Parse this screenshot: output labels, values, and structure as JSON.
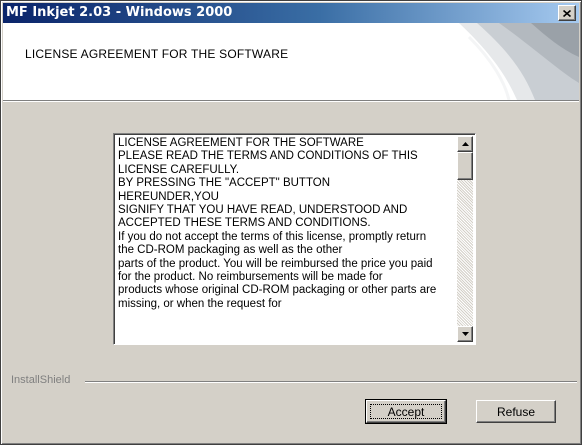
{
  "window": {
    "title": "MF Inkjet  2.03 - Windows 2000"
  },
  "header": {
    "title": "LICENSE AGREEMENT FOR THE SOFTWARE"
  },
  "license": {
    "lines": [
      "LICENSE AGREEMENT FOR THE SOFTWARE",
      "PLEASE READ THE TERMS AND CONDITIONS OF THIS",
      "LICENSE CAREFULLY.",
      "BY PRESSING THE \"ACCEPT\" BUTTON",
      "HEREUNDER,YOU",
      "SIGNIFY THAT YOU HAVE READ, UNDERSTOOD AND",
      "ACCEPTED THESE TERMS AND CONDITIONS.",
      "If you do not accept the terms of this license, promptly return",
      "the CD-ROM packaging as well as the other",
      "parts of the product. You will be reimbursed the price you paid",
      "for the product. No reimbursements will be made for",
      "products whose original CD-ROM packaging or other parts are",
      "missing, or when the request for"
    ]
  },
  "footer": {
    "brand": "InstallShield"
  },
  "buttons": {
    "accept": "Accept",
    "refuse": "Refuse"
  },
  "icons": {
    "close": "close-icon",
    "scroll_up": "arrow-up-icon",
    "scroll_down": "arrow-down-icon"
  },
  "colors": {
    "titlebar_start": "#0a246a",
    "titlebar_end": "#a6caf0",
    "dialog_face": "#d4d0c8"
  }
}
